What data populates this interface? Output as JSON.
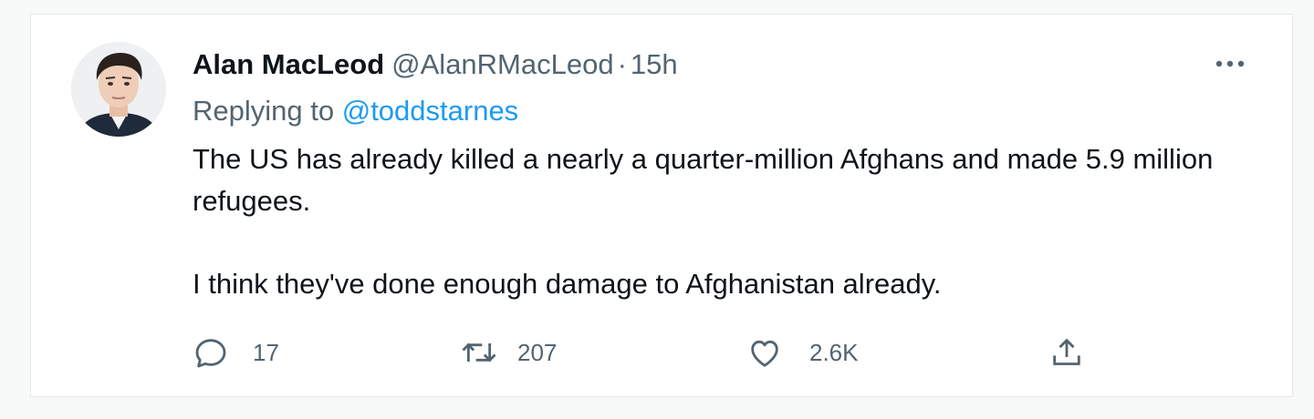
{
  "tweet": {
    "author_name": "Alan MacLeod",
    "author_handle": "@AlanRMacLeod",
    "separator": "·",
    "time": "15h",
    "replying_label": "Replying to",
    "replying_handle": "@toddstarnes",
    "text_paragraph_1": "The US has already killed a nearly a quarter-million Afghans and made 5.9 million refugees.",
    "text_paragraph_2": "I think they've done enough damage to Afghanistan already.",
    "more_icon": "more-horizontal-icon"
  },
  "actions": {
    "reply": {
      "icon": "reply-icon",
      "count": "17"
    },
    "retweet": {
      "icon": "retweet-icon",
      "count": "207"
    },
    "like": {
      "icon": "like-heart-icon",
      "count": "2.6K"
    },
    "share": {
      "icon": "share-icon"
    }
  },
  "colors": {
    "background": "#f7f9f9",
    "card": "#ffffff",
    "text_primary": "#0f1419",
    "text_secondary": "#536471",
    "link": "#1d9bf0",
    "border": "#e7e9ea"
  }
}
